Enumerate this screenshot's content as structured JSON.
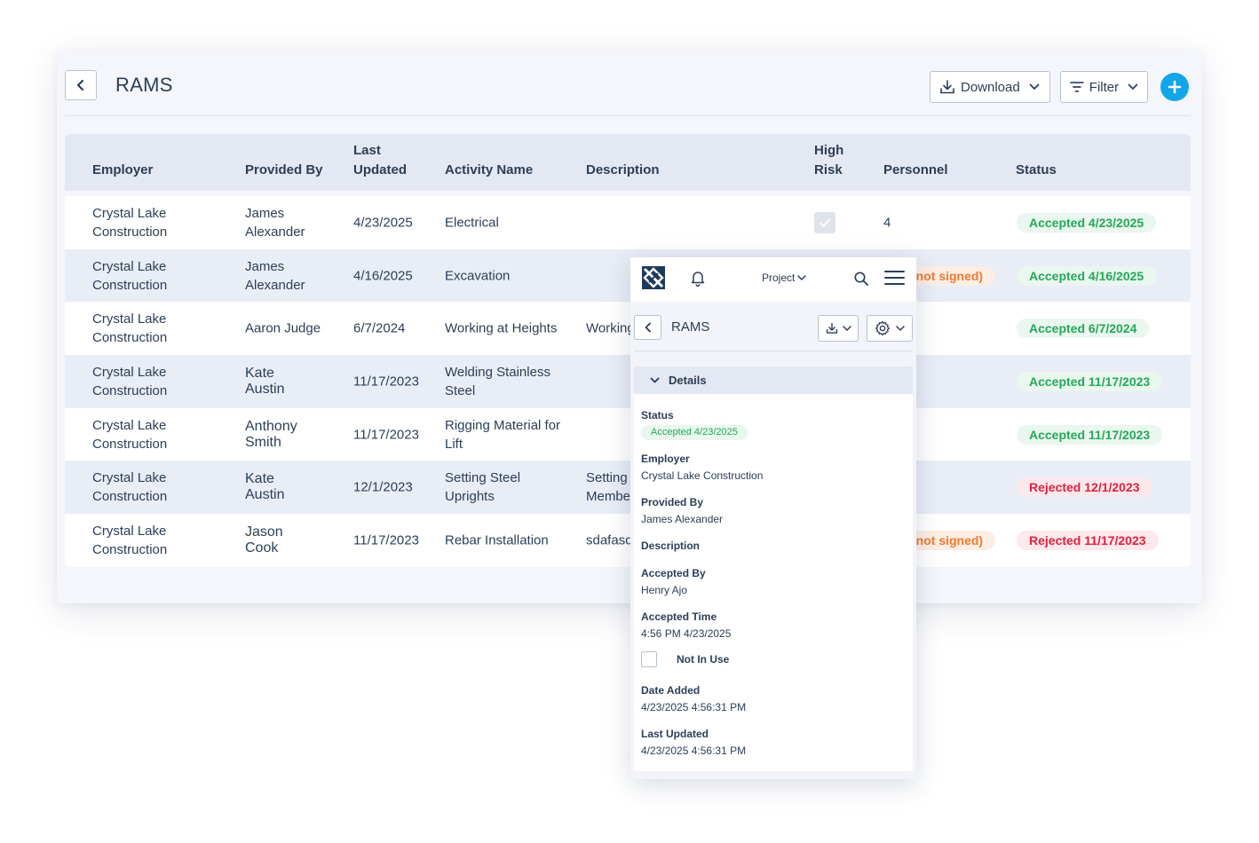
{
  "header": {
    "title": "RAMS",
    "download_label": "Download",
    "filter_label": "Filter"
  },
  "table": {
    "columns": {
      "employer": "Employer",
      "provided_by": "Provided By",
      "last_updated": "Last\nUpdated",
      "activity_name": "Activity Name",
      "description": "Description",
      "high_risk": "High\nRisk",
      "personnel": "Personnel",
      "status": "Status"
    },
    "rows": [
      {
        "employer": "Crystal Lake\nConstruction",
        "provided_by": "James\nAlexander",
        "last_updated": "4/23/2025",
        "activity": "Electrical",
        "description": "",
        "personnel": "4",
        "status": "Accepted 4/23/2025"
      },
      {
        "employer": "Crystal Lake\nConstruction",
        "provided_by": "James\nAlexander",
        "last_updated": "4/16/2025",
        "activity": "Excavation",
        "description": "",
        "personnel_note": "(not signed)",
        "status": "Accepted 4/16/2025"
      },
      {
        "employer": "Crystal Lake\nConstruction",
        "provided_by": "Aaron Judge",
        "last_updated": "6/7/2024",
        "activity": "Working at Heights",
        "description": "Working",
        "status": "Accepted 6/7/2024"
      },
      {
        "employer": "Crystal Lake\nConstruction",
        "provided_by": "Kate\nAustin",
        "last_updated": "11/17/2023",
        "activity": "Welding Stainless\nSteel",
        "description": "",
        "status": "Accepted 11/17/2023"
      },
      {
        "employer": "Crystal Lake\nConstruction",
        "provided_by": "Anthony\nSmith",
        "last_updated": "11/17/2023",
        "activity": "Rigging Material for\nLift",
        "description": "",
        "status": "Accepted 11/17/2023"
      },
      {
        "employer": "Crystal Lake\nConstruction",
        "provided_by": "Kate\nAustin",
        "last_updated": "12/1/2023",
        "activity": "Setting Steel\nUprights",
        "description": "Setting\nMembers",
        "status": "Rejected 12/1/2023"
      },
      {
        "employer": "Crystal Lake\nConstruction",
        "provided_by": "Jason\nCook",
        "last_updated": "11/17/2023",
        "activity": "Rebar Installation",
        "description": "sdafasdf",
        "personnel_note": "(not signed)",
        "status": "Rejected 11/17/2023"
      }
    ]
  },
  "mobile": {
    "project_label": "Project",
    "title": "RAMS",
    "section_label": "Details",
    "status_label": "Status",
    "status_value": "Accepted 4/23/2025",
    "employer_label": "Employer",
    "employer_value": "Crystal Lake Construction",
    "provided_by_label": "Provided By",
    "provided_by_value": "James Alexander",
    "description_label": "Description",
    "accepted_by_label": "Accepted By",
    "accepted_by_value": "Henry Ajo",
    "accepted_time_label": "Accepted Time",
    "accepted_time_value": "4:56 PM 4/23/2025",
    "not_in_use_label": "Not In Use",
    "date_added_label": "Date Added",
    "date_added_value": "4/23/2025 4:56:31 PM",
    "last_updated_label": "Last Updated",
    "last_updated_value": "4/23/2025 4:56:31 PM"
  },
  "colors": {
    "accent": "#11a6e8",
    "accepted": "#25a85a",
    "rejected": "#e0213c",
    "not_signed": "#ef7a2e"
  }
}
